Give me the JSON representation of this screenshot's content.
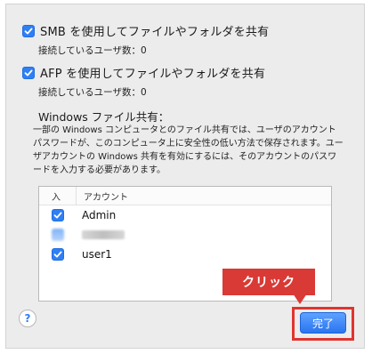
{
  "smb": {
    "label": "SMB を使用してファイルやフォルダを共有",
    "checked": true,
    "connected": "接続しているユーザ数：0"
  },
  "afp": {
    "label": "AFP を使用してファイルやフォルダを共有",
    "checked": true,
    "connected": "接続しているユーザ数：0"
  },
  "windows": {
    "title": "Windows ファイル共有：",
    "description": "一部の Windows コンピュータとのファイル共有では、ユーザのアカウントパスワードが、このコンピュータ上に安全性の低い方法で保存されます。ユーザアカウントの Windows 共有を有効にするには、そのアカウントのパスワードを入力する必要があります。"
  },
  "table": {
    "headers": {
      "enabled": "入",
      "account": "アカウント"
    },
    "rows": [
      {
        "name": "Admin",
        "checked": true
      },
      {
        "name": "",
        "checked": true
      },
      {
        "name": "user1",
        "checked": true
      }
    ]
  },
  "help": {
    "icon": "question-icon",
    "label": "?"
  },
  "callout": {
    "label": "クリック"
  },
  "done": {
    "label": "完了"
  },
  "colors": {
    "accent": "#2f7ff5",
    "callout": "#d93a35"
  }
}
